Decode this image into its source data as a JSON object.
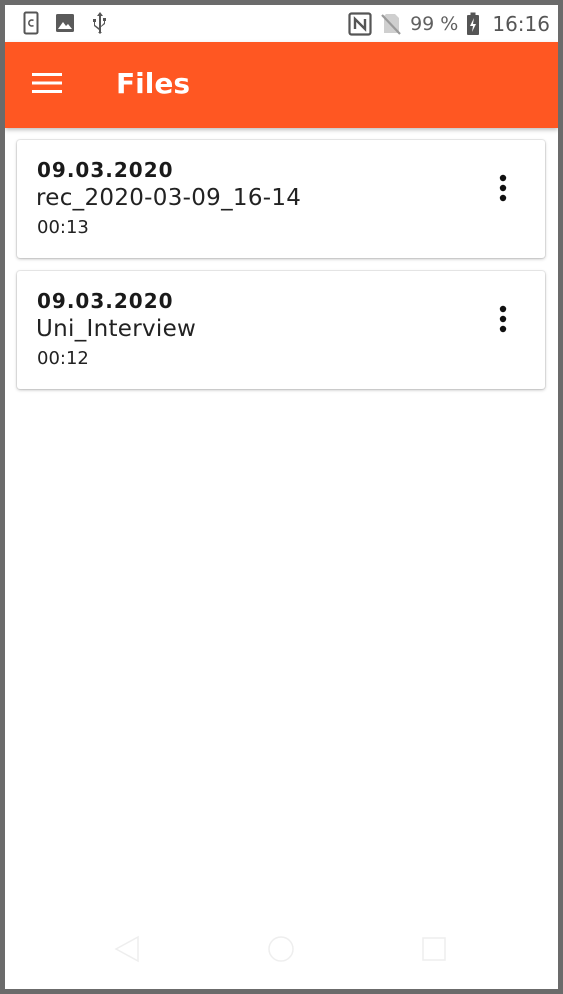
{
  "status_bar": {
    "left_icons": [
      "clipboard-icon",
      "image-icon",
      "usb-icon"
    ],
    "right_icons": [
      "nfc-icon",
      "no-sim-icon",
      "battery-charging-icon"
    ],
    "battery_text": "99 %",
    "time": "16:16"
  },
  "app_bar": {
    "title": "Files",
    "menu_icon": "hamburger-menu-icon",
    "color": "#ff5722"
  },
  "files": [
    {
      "date": "09.03.2020",
      "name": "rec_2020-03-09_16-14",
      "duration": "00:13"
    },
    {
      "date": "09.03.2020",
      "name": "Uni_Interview",
      "duration": "00:12"
    }
  ],
  "nav_bar": {
    "buttons": [
      "back-icon",
      "home-icon",
      "recents-icon"
    ]
  }
}
